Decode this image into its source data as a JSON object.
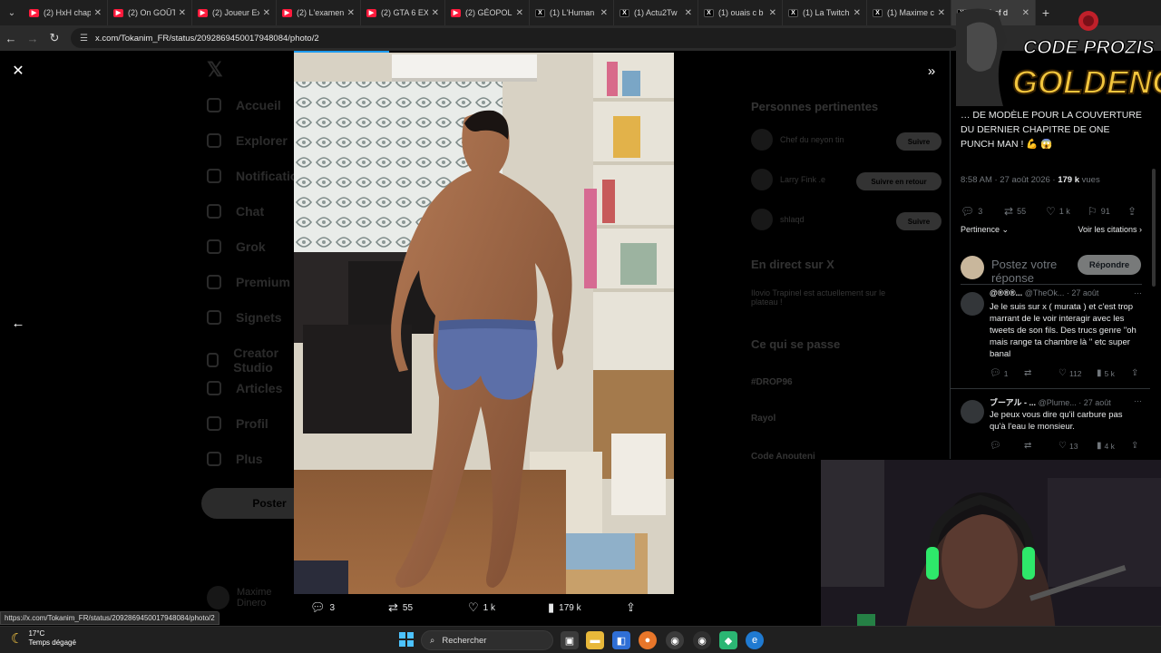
{
  "browser": {
    "tabs": [
      {
        "title": "(2) HxH chap",
        "icon": "youtube-icon"
      },
      {
        "title": "(2) On GOÛT",
        "icon": "youtube-icon"
      },
      {
        "title": "(2) Joueur Ex",
        "icon": "youtube-icon"
      },
      {
        "title": "(2) L'examen",
        "icon": "youtube-icon"
      },
      {
        "title": "(2) GTA 6 EX",
        "icon": "youtube-icon"
      },
      {
        "title": "(2) GÉOPOLI",
        "icon": "youtube-icon"
      },
      {
        "title": "(1) L'Human",
        "icon": "x-icon"
      },
      {
        "title": "(1) Actu2Tw",
        "icon": "x-icon"
      },
      {
        "title": "(1) ouais c b",
        "icon": "x-icon"
      },
      {
        "title": "(1) La Twitch",
        "icon": "x-icon"
      },
      {
        "title": "(1) Maxime c",
        "icon": "x-icon"
      },
      {
        "title": "(1) Chef d",
        "icon": "x-icon",
        "active": true
      }
    ],
    "url": "x.com/Tokanim_FR/status/2092869450017948084/photo/2",
    "status_url": "https://x.com/Tokanim_FR/status/2092869450017948084/photo/2"
  },
  "background_nav": {
    "items": [
      "Accueil",
      "Explorer",
      "Notifications",
      "Chat",
      "Grok",
      "Premium",
      "Signets",
      "Creator Studio",
      "Articles",
      "Profil",
      "Plus"
    ],
    "post_button": "Poster",
    "profile_name": "Maxime Dinero"
  },
  "background_right": {
    "relevant_title": "Personnes pertinentes",
    "people": [
      "Chef du neyon tin",
      "Larry Fink .e",
      "shlaqd"
    ],
    "follow_label": "Suivre",
    "follow_back_label": "Suivre en retour",
    "live_title": "En direct sur X",
    "live_item": "Ilovio Trapinel est actuellement sur le plateau !",
    "happening_title": "Ce qui se passe",
    "trends": [
      "#DROP96",
      "Rayol",
      "Code Anouteni"
    ]
  },
  "media_bar": {
    "replies": "3",
    "reposts": "55",
    "likes": "1 k",
    "views": "179 k"
  },
  "tweet": {
    "text": "… DE MODÈLE POUR LA COUVERTURE DU DERNIER CHAPITRE DE ONE PUNCH MAN ! 💪 😱",
    "time": "8:58 AM · 27 août 2026 ·",
    "views": "179 k",
    "views_label": "vues",
    "replies": "3",
    "reposts": "55",
    "likes": "1 k",
    "bookmarks": "91",
    "sort_label": "Pertinence",
    "quotes_label": "Voir les citations"
  },
  "reply_composer": {
    "placeholder": "Postez votre réponse",
    "button": "Répondre"
  },
  "comments": [
    {
      "name": "@®®®...",
      "handle": "@TheOk...",
      "date": "· 27 août",
      "text": "Je le suis sur x ( murata ) et c'est trop marrant de le voir interagir avec les tweets de son fils. Des trucs genre \"oh mais range ta chambre là \" etc super banal",
      "replies": "1",
      "reposts": "",
      "likes": "112",
      "views": "5 k"
    },
    {
      "name": "ブーアル - ...",
      "handle": "@Plume...",
      "date": "· 27 août",
      "text": "Je peux vous dire qu'il carbure pas qu'à l'eau le monsieur.",
      "replies": "",
      "reposts": "",
      "likes": "13",
      "views": "4 k"
    }
  ],
  "overlay": {
    "line1": "CODE PROZIS",
    "line2": "GOLDENG"
  },
  "taskbar": {
    "temperature": "17°C",
    "weather": "Temps dégagé",
    "search_label": "Rechercher"
  },
  "colors": {
    "accent": "#1d9bf0",
    "youtube": "#ff1a3c",
    "overlay_gold": "#f2c53d"
  }
}
